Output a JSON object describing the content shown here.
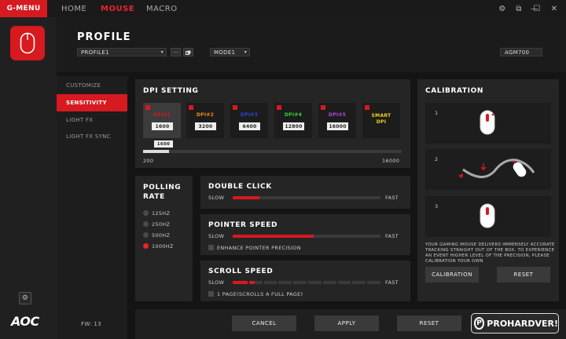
{
  "topbar": {
    "brand": "G-MENU",
    "nav": [
      {
        "label": "HOME"
      },
      {
        "label": "MOUSE"
      },
      {
        "label": "MACRO"
      }
    ],
    "controls": {
      "settings": "⚙",
      "restore": "⧉",
      "minimize": "—",
      "maximize": "☐",
      "close": "✕"
    }
  },
  "left": {
    "gear": "⚙",
    "logo_text": "AOC"
  },
  "header": {
    "title": "PROFILE",
    "profile_select": "PROFILE1",
    "more_button": "···",
    "mode_select": "MODE1",
    "model": "AGM700"
  },
  "sidemenu": {
    "items": [
      {
        "label": "CUSTOMIZE"
      },
      {
        "label": "SENSITIVITY"
      },
      {
        "label": "LIGHT FX"
      },
      {
        "label": "LIGHT FX SYNC"
      }
    ],
    "firmware": "FW: 13"
  },
  "dpi": {
    "title": "DPI SETTING",
    "levels": [
      {
        "name": "DPI#1",
        "value": "1600",
        "color": "#d71920"
      },
      {
        "name": "DPI#2",
        "value": "3200",
        "color": "#f08a12"
      },
      {
        "name": "DPI#3",
        "value": "6400",
        "color": "#2a48d8"
      },
      {
        "name": "DPI#4",
        "value": "12800",
        "color": "#3ad13a"
      },
      {
        "name": "DPI#5",
        "value": "16000",
        "color": "#b048d8"
      },
      {
        "name": "SMART",
        "value": "DPI",
        "color": "#f2d21a"
      }
    ],
    "slider_tooltip": "1600",
    "slider_fraction": 0.1,
    "min_label": "200",
    "max_label": "16000"
  },
  "polling": {
    "title_1": "POLLING",
    "title_2": "RATE",
    "options": [
      {
        "label": "125HZ"
      },
      {
        "label": "250HZ"
      },
      {
        "label": "500HZ"
      },
      {
        "label": "1000HZ"
      }
    ],
    "selected_index": 3
  },
  "double_click": {
    "title": "DOUBLE CLICK",
    "slow": "SLOW",
    "fast": "FAST",
    "fraction": 0.18
  },
  "pointer_speed": {
    "title": "POINTER SPEED",
    "slow": "SLOW",
    "fast": "FAST",
    "fraction": 0.55,
    "enhance_label": "ENHANCE POINTER PRECISION"
  },
  "scroll_speed": {
    "title": "SCROLL SPEED",
    "slow": "SLOW",
    "fast": "FAST",
    "fraction": 0.15,
    "page_label": "1 PAGE(SCROLLS A FULL PAGE)"
  },
  "calibration": {
    "title": "CALIBRATION",
    "steps": [
      "1",
      "2",
      "3"
    ],
    "description": "YOUR GAMING MOUSE DELIVERS IMMENSELY ACCURATE TRACKING STRAIGHT OUT OF THE BOX. TO EXPERIENCE AN EVENT HIGHER LEVEL OF THE PRECISION, PLEASE CALIBRATION YOUR OWN",
    "calibration_button": "CALIBRATION",
    "reset_button": "RESET"
  },
  "footer": {
    "cancel": "CANCEL",
    "apply": "APPLY",
    "reset": "RESET"
  },
  "watermark": {
    "mark": "P",
    "text": "PROHARDVER!"
  }
}
